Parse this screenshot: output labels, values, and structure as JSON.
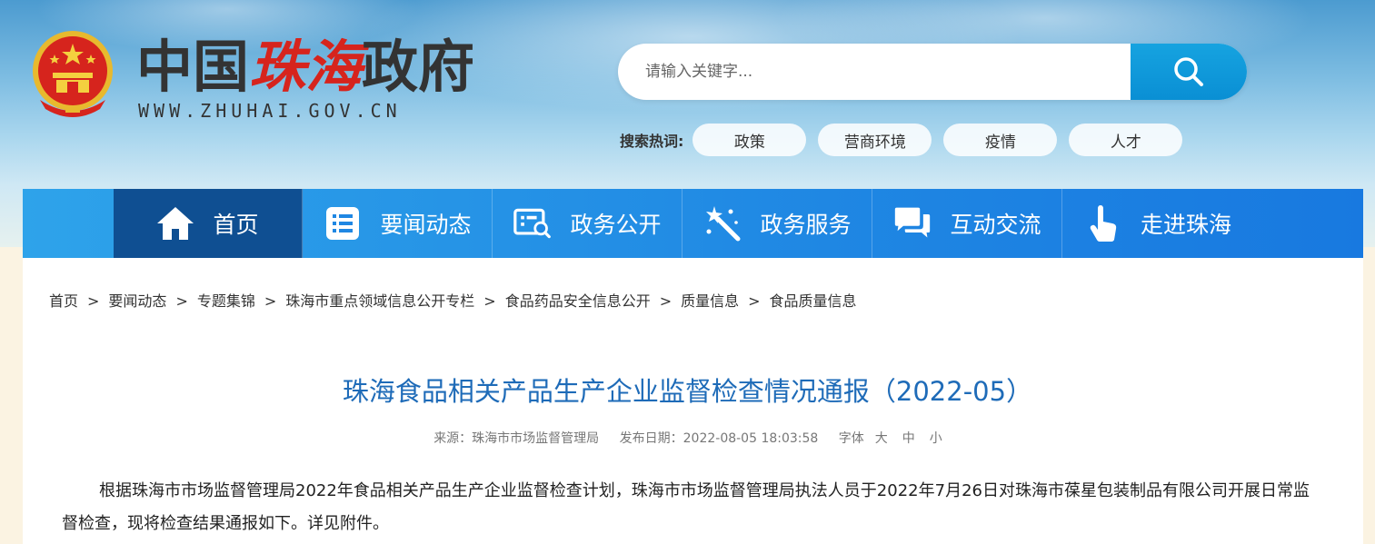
{
  "header": {
    "site_name_1": "中国",
    "site_name_2": "珠海",
    "site_name_3": "政府",
    "site_url": "WWW.ZHUHAI.GOV.CN",
    "emblem_icon": "national-emblem-icon"
  },
  "search": {
    "placeholder": "请输入关键字...",
    "button_icon": "search-icon"
  },
  "hot_search": {
    "label": "搜索热词:",
    "tags": [
      "政策",
      "营商环境",
      "疫情",
      "人才"
    ]
  },
  "nav": {
    "items": [
      {
        "label": "首页",
        "icon": "home-icon",
        "active": true
      },
      {
        "label": "要闻动态",
        "icon": "news-list-icon"
      },
      {
        "label": "政务公开",
        "icon": "document-search-icon"
      },
      {
        "label": "政务服务",
        "icon": "magic-wand-icon"
      },
      {
        "label": "互动交流",
        "icon": "chat-bubbles-icon"
      },
      {
        "label": "走进珠海",
        "icon": "hand-pointer-icon"
      }
    ]
  },
  "breadcrumb": {
    "items": [
      "首页",
      "要闻动态",
      "专题集锦",
      "珠海市重点领域信息公开专栏",
      "食品药品安全信息公开",
      "质量信息",
      "食品质量信息"
    ],
    "separator": ">"
  },
  "article": {
    "title": "珠海食品相关产品生产企业监督检查情况通报（2022-05）",
    "source": "来源：珠海市市场监督管理局",
    "publish_date": "发布日期：2022-08-05 18:03:58",
    "font_size_label": "字体",
    "font_large": "大",
    "font_medium": "中",
    "font_small": "小",
    "body": "根据珠海市市场监督管理局2022年食品相关产品生产企业监督检查计划，珠海市市场监督管理局执法人员于2022年7月26日对珠海市葆星包装制品有限公司开展日常监督检查，现将检查结果通报如下。详见附件。"
  },
  "colors": {
    "nav_bg": "#1f87e3",
    "nav_active": "#0f4f92",
    "title": "#1e6bb8",
    "search_button": "#0a8fd4",
    "accent_red": "#d6241d"
  }
}
